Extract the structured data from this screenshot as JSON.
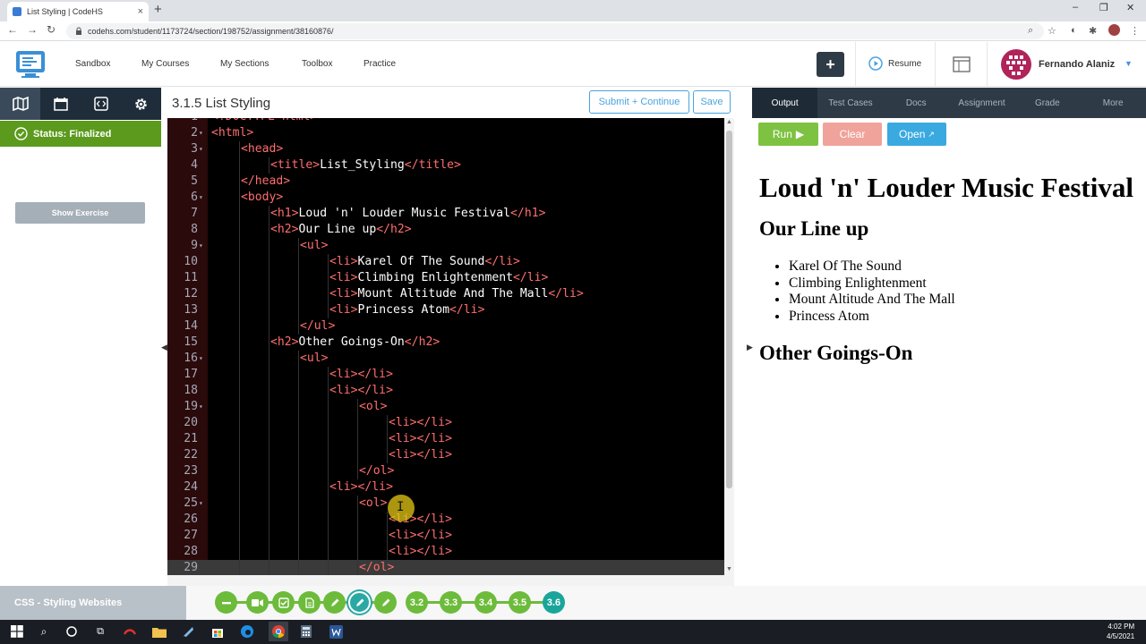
{
  "browser": {
    "tab_title": "List Styling | CodeHS",
    "tab_close": "×",
    "new_tab": "+",
    "url": "codehs.com/student/1173724/section/198752/assignment/38160876/",
    "window_controls": [
      "–",
      "❐",
      "✕"
    ]
  },
  "header": {
    "nav": [
      "Sandbox",
      "My Courses",
      "My Sections",
      "Toolbox",
      "Practice"
    ],
    "plus_label": "+",
    "resume_label": "Resume",
    "user_name": "Fernando Alaniz"
  },
  "sidebar": {
    "status_label": "Status: Finalized",
    "show_exercise_label": "Show Exercise"
  },
  "editor": {
    "title": "3.1.5 List Styling",
    "submit_label": "Submit + Continue",
    "save_label": "Save",
    "lines": [
      {
        "n": "1",
        "indent": 0,
        "parts": [
          [
            "tag",
            "<!DOCTYPE html>"
          ]
        ]
      },
      {
        "n": "2",
        "indent": 0,
        "parts": [
          [
            "tag",
            "<html>"
          ]
        ]
      },
      {
        "n": "3",
        "indent": 1,
        "parts": [
          [
            "tag",
            "<head>"
          ]
        ]
      },
      {
        "n": "4",
        "indent": 2,
        "parts": [
          [
            "tag",
            "<title>"
          ],
          [
            "txt",
            "List_Styling"
          ],
          [
            "tag",
            "</title>"
          ]
        ]
      },
      {
        "n": "5",
        "indent": 1,
        "parts": [
          [
            "tag",
            "</head>"
          ]
        ]
      },
      {
        "n": "6",
        "indent": 1,
        "parts": [
          [
            "tag",
            "<body>"
          ]
        ]
      },
      {
        "n": "7",
        "indent": 2,
        "parts": [
          [
            "tag",
            "<h1>"
          ],
          [
            "txt",
            "Loud 'n' Louder Music Festival"
          ],
          [
            "tag",
            "</h1>"
          ]
        ]
      },
      {
        "n": "8",
        "indent": 2,
        "parts": [
          [
            "tag",
            "<h2>"
          ],
          [
            "txt",
            "Our Line up"
          ],
          [
            "tag",
            "</h2>"
          ]
        ]
      },
      {
        "n": "9",
        "indent": 3,
        "parts": [
          [
            "tag",
            "<ul>"
          ]
        ]
      },
      {
        "n": "10",
        "indent": 4,
        "parts": [
          [
            "tag",
            "<li>"
          ],
          [
            "txt",
            "Karel Of The Sound"
          ],
          [
            "tag",
            "</li>"
          ]
        ]
      },
      {
        "n": "11",
        "indent": 4,
        "parts": [
          [
            "tag",
            "<li>"
          ],
          [
            "txt",
            "Climbing Enlightenment"
          ],
          [
            "tag",
            "</li>"
          ]
        ]
      },
      {
        "n": "12",
        "indent": 4,
        "parts": [
          [
            "tag",
            "<li>"
          ],
          [
            "txt",
            "Mount Altitude And The Mall"
          ],
          [
            "tag",
            "</li>"
          ]
        ]
      },
      {
        "n": "13",
        "indent": 4,
        "parts": [
          [
            "tag",
            "<li>"
          ],
          [
            "txt",
            "Princess Atom"
          ],
          [
            "tag",
            "</li>"
          ]
        ]
      },
      {
        "n": "14",
        "indent": 3,
        "parts": [
          [
            "tag",
            "</ul>"
          ]
        ]
      },
      {
        "n": "15",
        "indent": 2,
        "parts": [
          [
            "tag",
            "<h2>"
          ],
          [
            "txt",
            "Other Goings-On"
          ],
          [
            "tag",
            "</h2>"
          ]
        ]
      },
      {
        "n": "16",
        "indent": 3,
        "parts": [
          [
            "tag",
            "<ul>"
          ]
        ]
      },
      {
        "n": "17",
        "indent": 4,
        "parts": [
          [
            "tag",
            "<li></li>"
          ]
        ]
      },
      {
        "n": "18",
        "indent": 4,
        "parts": [
          [
            "tag",
            "<li></li>"
          ]
        ]
      },
      {
        "n": "19",
        "indent": 5,
        "parts": [
          [
            "tag",
            "<ol>"
          ]
        ]
      },
      {
        "n": "20",
        "indent": 6,
        "parts": [
          [
            "tag",
            "<li></li>"
          ]
        ]
      },
      {
        "n": "21",
        "indent": 6,
        "parts": [
          [
            "tag",
            "<li></li>"
          ]
        ]
      },
      {
        "n": "22",
        "indent": 6,
        "parts": [
          [
            "tag",
            "<li></li>"
          ]
        ]
      },
      {
        "n": "23",
        "indent": 5,
        "parts": [
          [
            "tag",
            "</ol>"
          ]
        ]
      },
      {
        "n": "24",
        "indent": 4,
        "parts": [
          [
            "tag",
            "<li></li>"
          ]
        ]
      },
      {
        "n": "25",
        "indent": 5,
        "parts": [
          [
            "tag",
            "<ol>"
          ]
        ]
      },
      {
        "n": "26",
        "indent": 6,
        "parts": [
          [
            "tag",
            "<li></li>"
          ]
        ]
      },
      {
        "n": "27",
        "indent": 6,
        "parts": [
          [
            "tag",
            "<li></li>"
          ]
        ]
      },
      {
        "n": "28",
        "indent": 6,
        "parts": [
          [
            "tag",
            "<li></li>"
          ]
        ]
      },
      {
        "n": "29",
        "indent": 5,
        "parts": [
          [
            "tag",
            "</ol>"
          ]
        ]
      }
    ],
    "fold_lines": [
      "1",
      "2",
      "3",
      "6",
      "9",
      "16",
      "19",
      "25"
    ]
  },
  "output_panel": {
    "tabs": [
      "Output",
      "Test Cases",
      "Docs",
      "Assignment",
      "Grade",
      "More"
    ],
    "active_tab": "Output",
    "run_label": "Run",
    "clear_label": "Clear",
    "open_label": "Open",
    "render": {
      "h1": "Loud 'n' Louder Music Festival",
      "h2_first": "Our Line up",
      "items": [
        "Karel Of The Sound",
        "Climbing Enlightenment",
        "Mount Altitude And The Mall",
        "Princess Atom"
      ],
      "h2_second": "Other Goings-On"
    }
  },
  "course_bar": {
    "course_name": "CSS - Styling Websites",
    "sections": [
      "3.2",
      "3.3",
      "3.4",
      "3.5",
      "3.6"
    ]
  },
  "taskbar": {
    "time": "4:02 PM",
    "date": "4/5/2021"
  },
  "colors": {
    "code_bg": "#000000",
    "tag": "#ff6e6e",
    "status_green": "#5b9a1c",
    "accent_blue": "#4aa3df"
  }
}
